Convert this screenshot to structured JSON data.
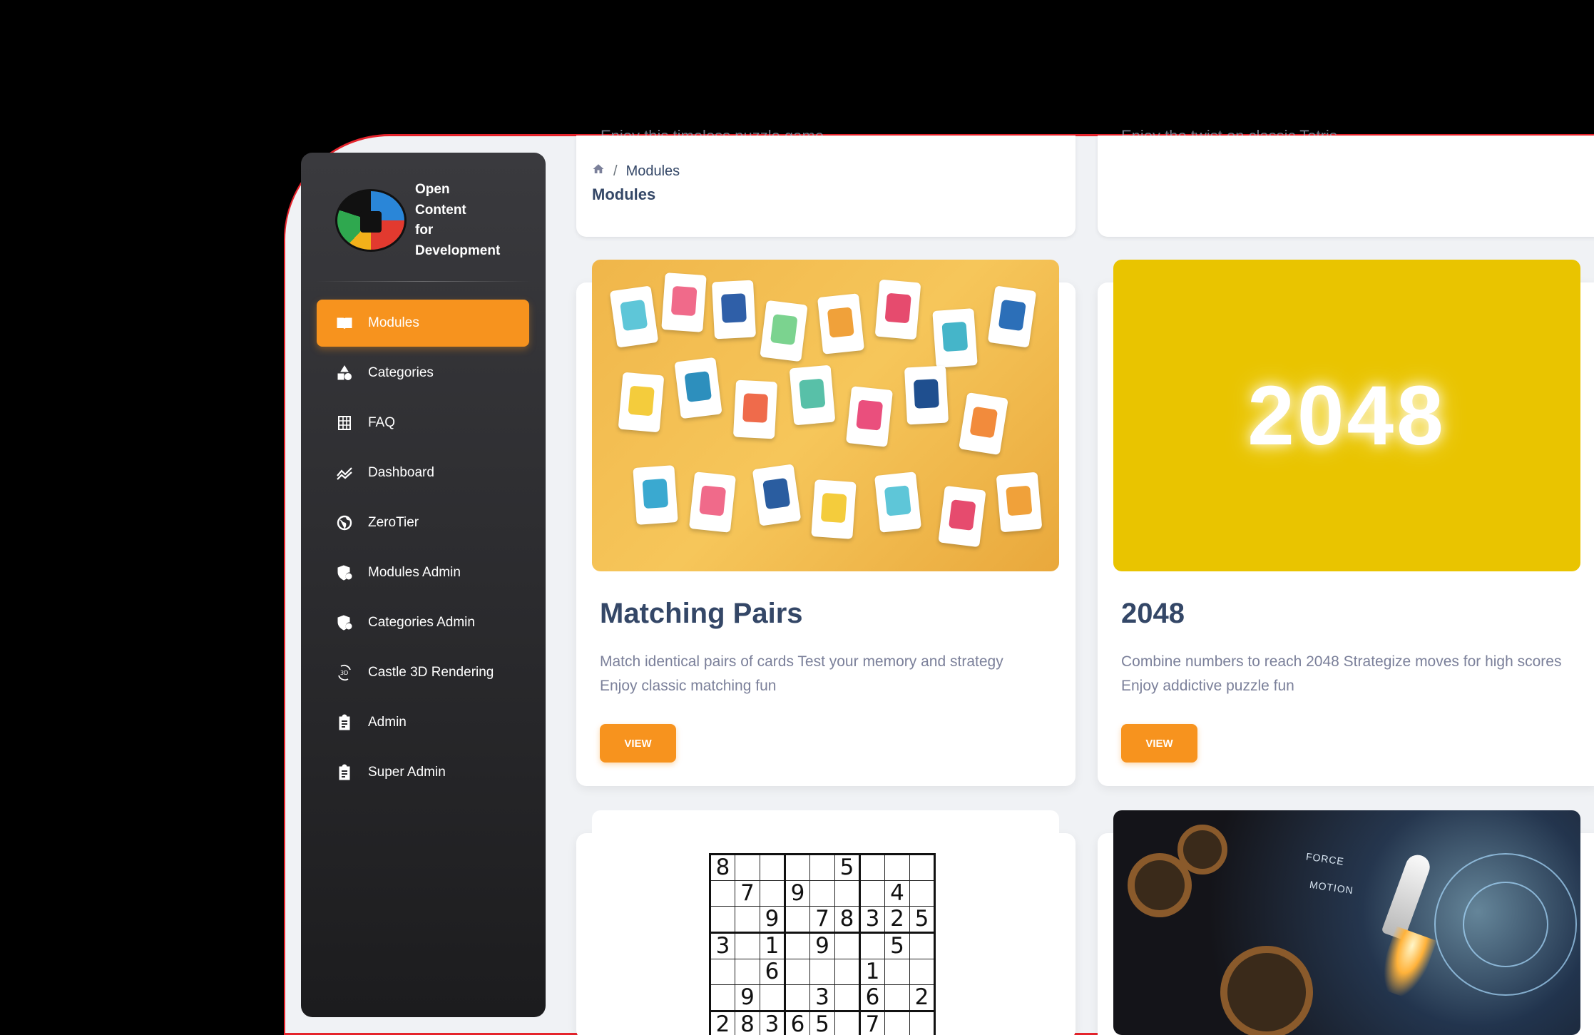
{
  "brand": {
    "name_lines": [
      "Open",
      "Content",
      "for",
      "Development"
    ]
  },
  "sidebar": {
    "items": [
      {
        "label": "Modules",
        "icon": "book-icon",
        "active": true
      },
      {
        "label": "Categories",
        "icon": "shapes-icon",
        "active": false
      },
      {
        "label": "FAQ",
        "icon": "grid-icon",
        "active": false
      },
      {
        "label": "Dashboard",
        "icon": "chart-icon",
        "active": false
      },
      {
        "label": "ZeroTier",
        "icon": "globe-icon",
        "active": false
      },
      {
        "label": "Modules Admin",
        "icon": "shield-icon",
        "active": false
      },
      {
        "label": "Categories Admin",
        "icon": "shield-icon",
        "active": false
      },
      {
        "label": "Castle 3D Rendering",
        "icon": "3d-rotation-icon",
        "active": false
      },
      {
        "label": "Admin",
        "icon": "clipboard-icon",
        "active": false
      },
      {
        "label": "Super Admin",
        "icon": "clipboard-icon",
        "active": false
      }
    ]
  },
  "header": {
    "breadcrumb_current": "Modules",
    "page_title": "Modules",
    "ghost_left": "Enjoy this timeless puzzle game",
    "ghost_right": "Enjoy the twist on classic Tetris"
  },
  "cards": [
    {
      "title": "Matching Pairs",
      "description": "Match identical pairs of cards Test your memory and strategy Enjoy classic matching fun",
      "button": "VIEW"
    },
    {
      "title": "2048",
      "description": "Combine numbers to reach 2048 Strategize moves for high scores Enjoy addictive puzzle fun",
      "button": "VIEW",
      "image_text": "2048"
    }
  ],
  "sudoku_rows": [
    [
      "8",
      "",
      "",
      "",
      "",
      "5",
      "",
      "",
      ""
    ],
    [
      "",
      "7",
      "",
      "9",
      "",
      "",
      "",
      "4",
      ""
    ],
    [
      "",
      "",
      "9",
      "",
      "7",
      "8",
      "3",
      "2",
      "5"
    ],
    [
      "3",
      "",
      "1",
      "",
      "9",
      "",
      "",
      "5",
      ""
    ],
    [
      "",
      "",
      "6",
      "",
      "",
      "",
      "1",
      "",
      ""
    ],
    [
      "",
      "9",
      "",
      "",
      "3",
      "",
      "6",
      "",
      "2"
    ],
    [
      "2",
      "8",
      "3",
      "6",
      "5",
      "",
      "7",
      "",
      ""
    ]
  ],
  "physics_labels": [
    "FORCE",
    "MOTION"
  ],
  "colors": {
    "accent": "#f7931e",
    "title": "#344767",
    "frame_border": "#e5242c"
  }
}
